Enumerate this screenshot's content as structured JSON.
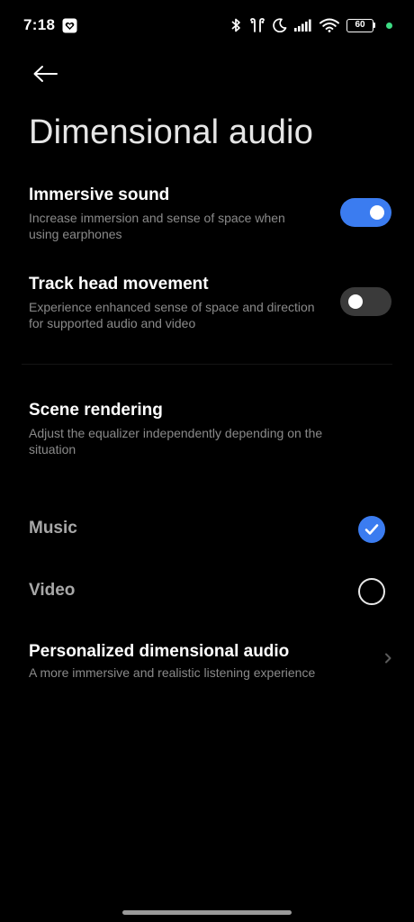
{
  "status_bar": {
    "time": "7:18",
    "battery": "60"
  },
  "page": {
    "title": "Dimensional audio"
  },
  "immersive_sound": {
    "title": "Immersive sound",
    "description": "Increase immersion and sense of space when using earphones",
    "enabled": true
  },
  "track_head": {
    "title": "Track head movement",
    "description": "Experience enhanced sense of space and direction for supported audio and video",
    "enabled": false
  },
  "scene_rendering": {
    "title": "Scene rendering",
    "description": "Adjust the equalizer independently depending on the situation",
    "options": [
      {
        "label": "Music",
        "selected": true
      },
      {
        "label": "Video",
        "selected": false
      }
    ]
  },
  "personalized": {
    "title": "Personalized dimensional audio",
    "description": "A more immersive and realistic listening experience"
  },
  "colors": {
    "accent": "#3b7cf0",
    "background": "#000000",
    "secondary_text": "#8a8a8a"
  }
}
